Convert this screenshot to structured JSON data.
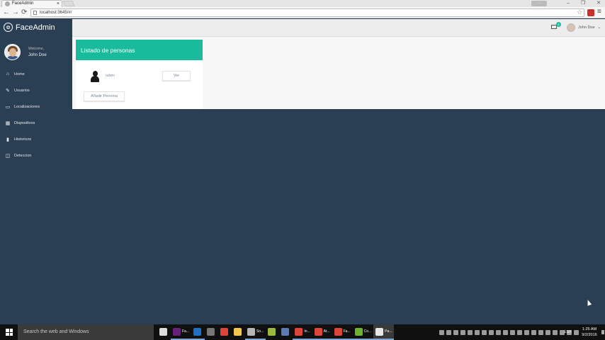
{
  "browser": {
    "tab_title": "FaceAdmin",
    "tab_close": "×",
    "url": "localhost:3645/#/",
    "user_chip": "···",
    "back": "←",
    "forward": "→",
    "reload": "⟳",
    "star": "☆",
    "menu": "≡"
  },
  "sidebar": {
    "brand": "FaceAdmin",
    "welcome": "Welcome,",
    "user_name": "John Doe",
    "items": [
      {
        "label": "Home",
        "icon": "⌂"
      },
      {
        "label": "Usuarios",
        "icon": "✎"
      },
      {
        "label": "Localizaciones",
        "icon": "▭"
      },
      {
        "label": "Dispositivos",
        "icon": "▦"
      },
      {
        "label": "Historicos",
        "icon": "▮"
      },
      {
        "label": "Deteccion",
        "icon": "◫"
      }
    ]
  },
  "topnav": {
    "user_name": "John Doe",
    "caret": "⌄",
    "badge_count": "6"
  },
  "panel": {
    "title": "Listado de personas",
    "person_name": "ruben",
    "view_button": "Ver",
    "add_button": "Añadir Persona"
  },
  "taskbar": {
    "search_placeholder": "Search the web and Windows",
    "apps": [
      {
        "label": "",
        "color": "#dddddd",
        "open": false,
        "active": false
      },
      {
        "label": "Fa...",
        "color": "#68217a",
        "open": true,
        "active": false
      },
      {
        "label": "",
        "color": "#1f6fc5",
        "open": true,
        "active": false
      },
      {
        "label": "",
        "color": "#777777",
        "open": false,
        "active": false
      },
      {
        "label": "",
        "color": "#e0453a",
        "open": false,
        "active": false
      },
      {
        "label": "",
        "color": "#f2c94c",
        "open": false,
        "active": false
      },
      {
        "label": "Sn...",
        "color": "#b5b5b5",
        "open": true,
        "active": false
      },
      {
        "label": "",
        "color": "#9bb93a",
        "open": false,
        "active": false
      },
      {
        "label": "",
        "color": "#5a7bb8",
        "open": false,
        "active": false
      },
      {
        "label": "In...",
        "color": "#e0453a",
        "open": true,
        "active": false
      },
      {
        "label": "At...",
        "color": "#e0453a",
        "open": true,
        "active": false
      },
      {
        "label": "Fa...",
        "color": "#e0453a",
        "open": true,
        "active": false
      },
      {
        "label": "Co...",
        "color": "#6ab32b",
        "open": true,
        "active": false
      },
      {
        "label": "Pa...",
        "color": "#e8e8e8",
        "open": true,
        "active": true
      }
    ],
    "language": "ESP",
    "time": "1:25 AM",
    "date": "9/2/2016"
  }
}
